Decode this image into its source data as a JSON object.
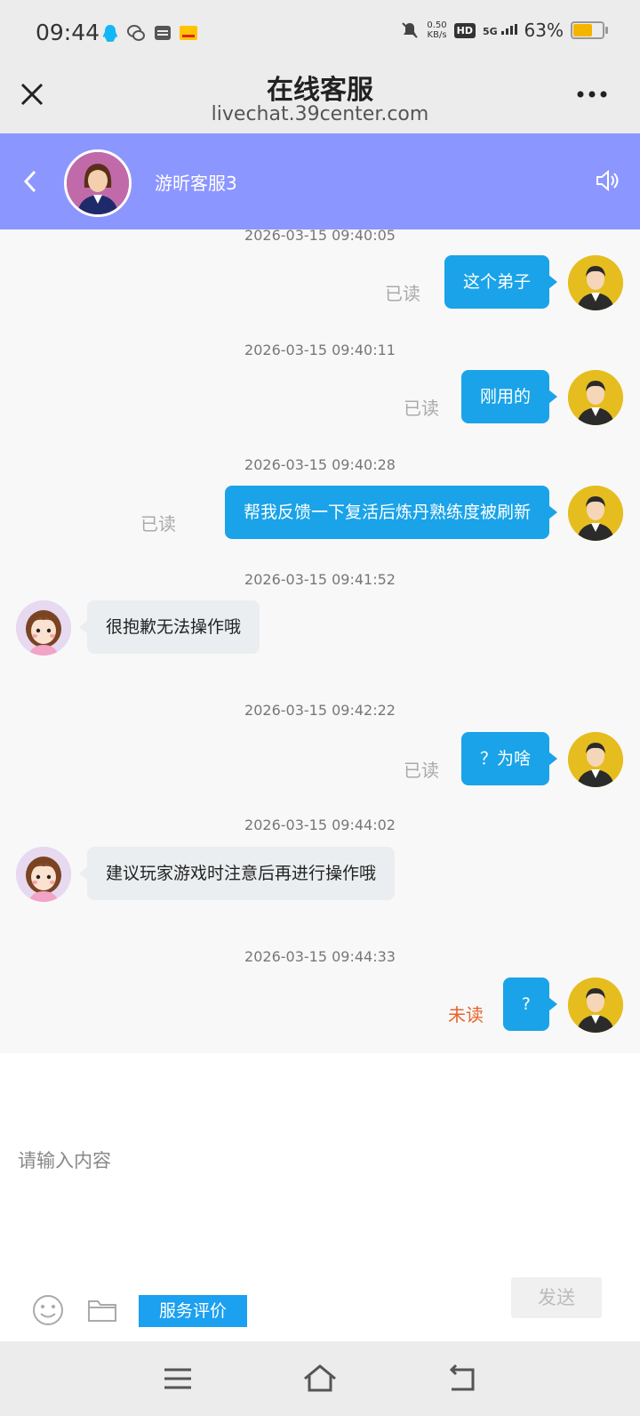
{
  "status_bar": {
    "time": "09:44",
    "net_speed_value": "0.50",
    "net_speed_unit": "KB/s",
    "hd": "HD",
    "signal": "5G",
    "battery_percent": "63%",
    "battery_level": 0.63,
    "battery_color": "#f5b400",
    "app_icons": [
      "qq-icon",
      "wechat-icon",
      "wallet-icon",
      "meituan-icon"
    ]
  },
  "browser": {
    "title": "在线客服",
    "url": "livechat.39center.com"
  },
  "chat_header": {
    "agent_name": "游昕客服3",
    "background_color": "#8c96ff"
  },
  "messages": [
    {
      "timestamp": "2026-03-15 09:40:05",
      "side": "out",
      "text": "这个弟子",
      "status": "已读"
    },
    {
      "timestamp": "2026-03-15 09:40:11",
      "side": "out",
      "text": "刚用的",
      "status": "已读"
    },
    {
      "timestamp": "2026-03-15 09:40:28",
      "side": "out",
      "text": "帮我反馈一下复活后炼丹熟练度被刷新",
      "status": "已读"
    },
    {
      "timestamp": "2026-03-15 09:41:52",
      "side": "in",
      "text": "很抱歉无法操作哦"
    },
    {
      "timestamp": "2026-03-15 09:42:22",
      "side": "out",
      "text": "？为啥",
      "status": "已读"
    },
    {
      "timestamp": "2026-03-15 09:44:02",
      "side": "in",
      "text": "建议玩家游戏时注意后再进行操作哦"
    },
    {
      "timestamp": "2026-03-15 09:44:33",
      "side": "out",
      "text": "?",
      "status": "未读"
    }
  ],
  "input": {
    "placeholder": "请输入内容",
    "value": ""
  },
  "toolbar": {
    "rate_label": "服务评价",
    "send_label": "发送"
  },
  "colors": {
    "outgoing_bubble": "#1aa3e8",
    "incoming_bubble": "#ebeef0",
    "unread": "#e8632c",
    "rate_button": "#1ca0f0"
  }
}
